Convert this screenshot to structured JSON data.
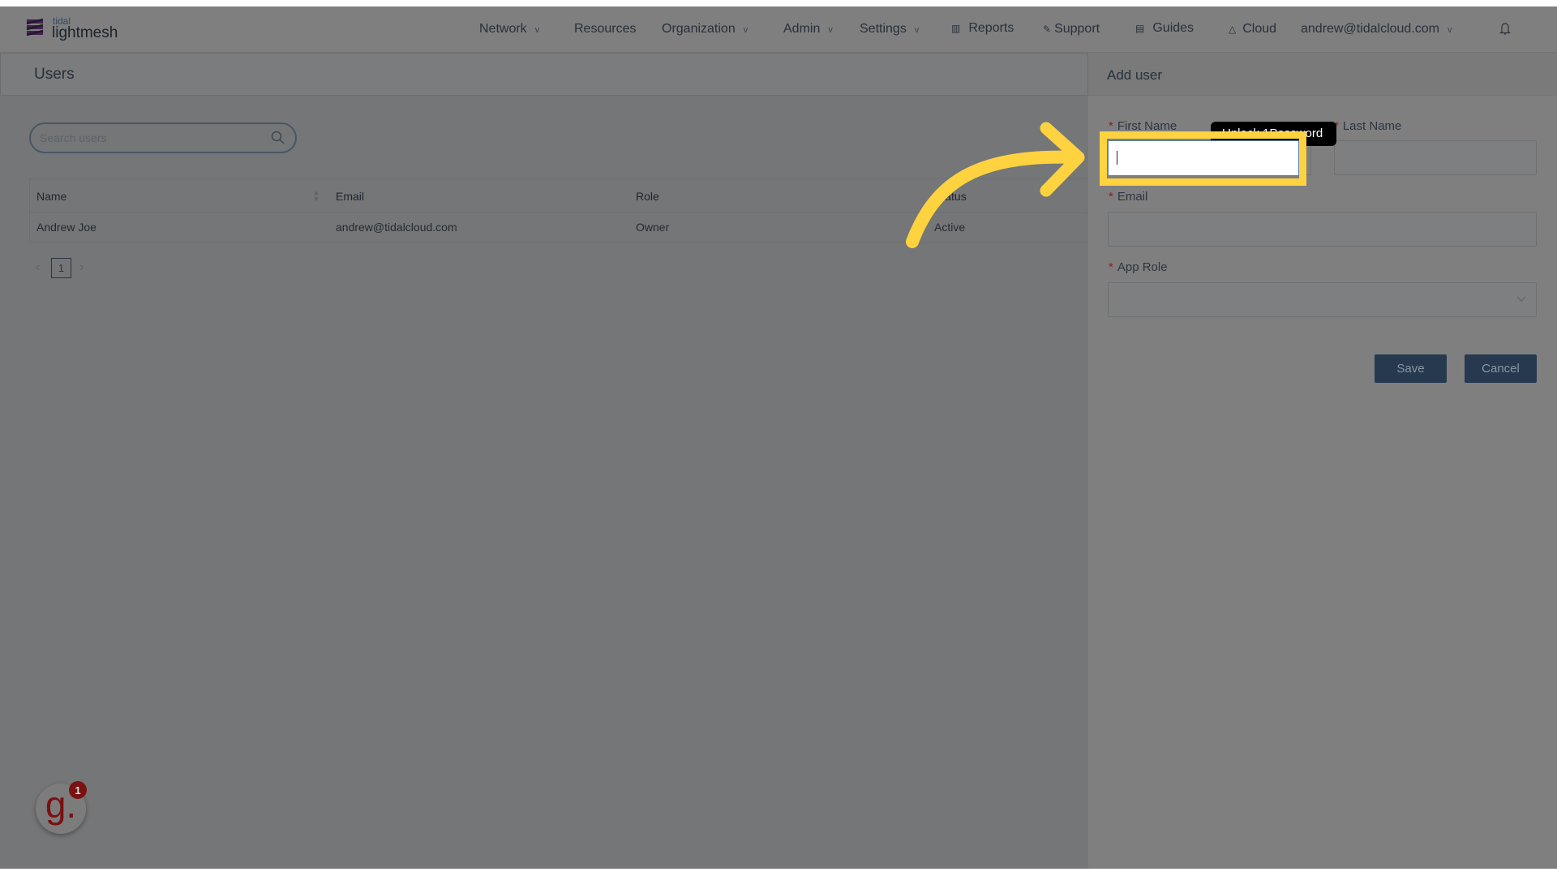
{
  "brand": {
    "small": "tidal",
    "name": "lightmesh"
  },
  "nav": {
    "items": [
      {
        "label": "Network",
        "dropdown": true
      },
      {
        "label": "Resources",
        "dropdown": false
      },
      {
        "label": "Organization",
        "dropdown": true
      },
      {
        "label": "Admin",
        "dropdown": true
      },
      {
        "label": "Settings",
        "dropdown": true
      },
      {
        "label": "Reports",
        "icon": "bar-chart-icon"
      },
      {
        "label": "Support",
        "icon": "wrench-icon"
      },
      {
        "label": "Guides",
        "icon": "book-icon"
      },
      {
        "label": "Cloud",
        "icon": "cloud-icon"
      }
    ],
    "user": "andrew@tidalcloud.com",
    "chevron": "v"
  },
  "page": {
    "title": "Users",
    "search_placeholder": "Search users"
  },
  "table": {
    "columns": [
      "Name",
      "Email",
      "Role",
      "Status"
    ],
    "rows": [
      [
        "Andrew Joe",
        "andrew@tidalcloud.com",
        "Owner",
        "Active"
      ]
    ]
  },
  "pagination": {
    "prev": "‹",
    "current": "1",
    "next": "›"
  },
  "panel": {
    "title": "Add user",
    "required": "*",
    "first_name": "First Name",
    "last_name": "Last Name",
    "email": "Email",
    "app_role": "App Role",
    "save": "Save",
    "cancel": "Cancel",
    "tooltip": "Unlock 1Password"
  },
  "widget": {
    "letter": "g.",
    "badge": "1"
  },
  "colors": {
    "highlight": "#ffd23f",
    "button": "#26394f",
    "overlay": "#7f7f7f"
  }
}
